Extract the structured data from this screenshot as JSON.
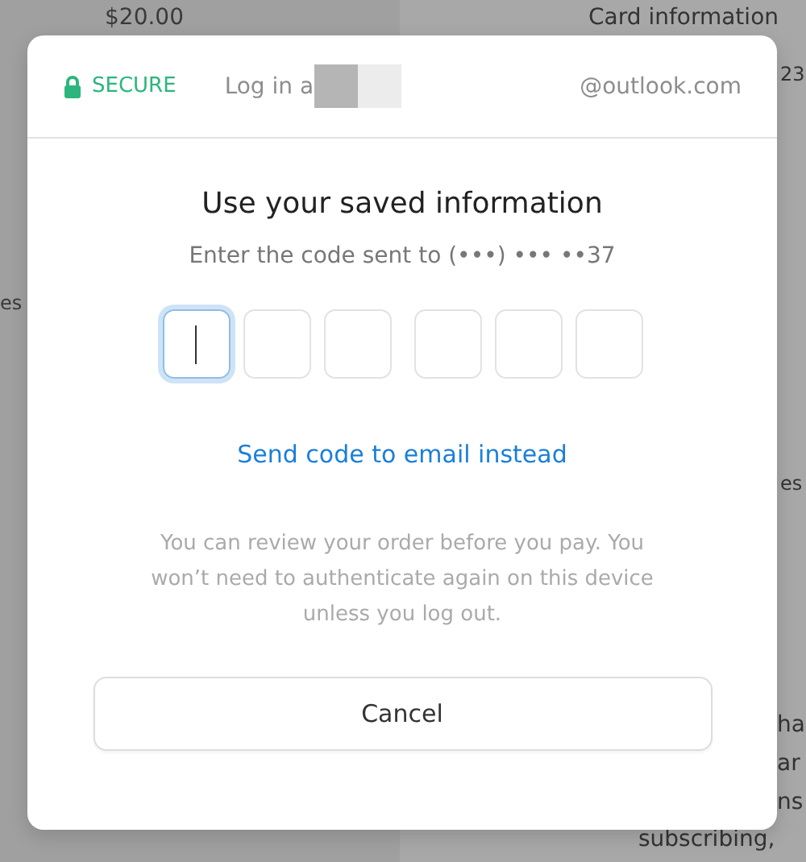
{
  "background": {
    "texts": [
      {
        "kind": "left",
        "text": "$20.00"
      },
      {
        "kind": "right",
        "text": "Card information"
      },
      {
        "kind": "right",
        "text": "23"
      },
      {
        "kind": "left",
        "text": "es"
      },
      {
        "kind": "right",
        "text": "es"
      },
      {
        "kind": "right",
        "text": "ha"
      },
      {
        "kind": "right",
        "text": "ar"
      },
      {
        "kind": "right",
        "text": "ns"
      },
      {
        "kind": "right",
        "text": "subscribing,"
      }
    ]
  },
  "header": {
    "secure_label": "SECURE",
    "login_text": "Log in a",
    "email": "@outlook.com"
  },
  "title": "Use your saved information",
  "subtitle": "Enter the code sent to (•••) ••• ••37",
  "code_inputs": [
    {
      "selected": true
    },
    {
      "selected": false
    },
    {
      "selected": false
    },
    {
      "selected": false
    },
    {
      "selected": false
    },
    {
      "selected": false
    }
  ],
  "link": "Send code to email instead",
  "note": "You can review your order before you pay. You won’t need to authenticate again on this device unless you log out.",
  "buttons": [
    "Cancel"
  ]
}
